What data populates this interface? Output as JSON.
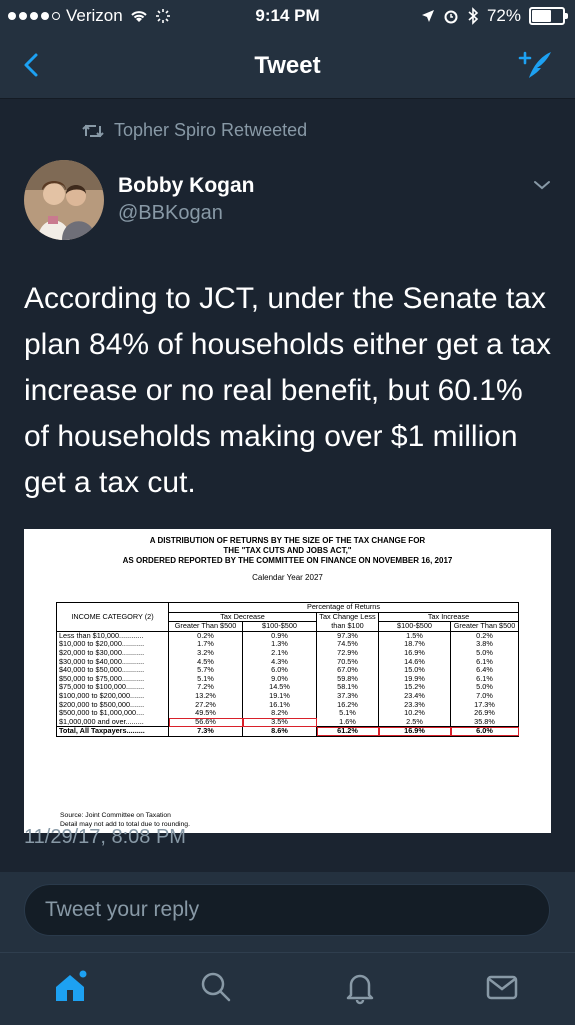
{
  "status_bar": {
    "carrier": "Verizon",
    "time": "9:14 PM",
    "battery": "72%",
    "battery_level": 0.72
  },
  "nav": {
    "title": "Tweet",
    "back_icon": "chevron-left-icon",
    "compose_icon": "compose-tweet-icon"
  },
  "tweet": {
    "retweeted_by": "Topher Spiro Retweeted",
    "author_name": "Bobby Kogan",
    "author_handle": "@BBKogan",
    "text": "According to JCT, under the Senate tax plan 84% of households either get a tax increase or no real benefit, but 60.1% of households making over $1 million get a tax cut.",
    "timestamp": "11/29/17, 8:08 PM"
  },
  "attached_table": {
    "title_lines": [
      "A DISTRIBUTION OF RETURNS BY THE SIZE OF THE TAX CHANGE FOR",
      "THE \"TAX CUTS AND JOBS ACT,\"",
      "AS ORDERED REPORTED BY THE COMMITTEE ON FINANCE ON NOVEMBER 16, 2017"
    ],
    "calendar_year": "Calendar Year 2027",
    "header": {
      "income_category": "INCOME CATEGORY (2)",
      "pct_returns": "Percentage of Returns",
      "tax_decrease": "Tax Decrease",
      "tax_change": "Tax Change Less than $100",
      "tax_increase": "Tax Increase",
      "dec_gt": "Greater Than $500",
      "dec_range": "$100-$500",
      "change_lt": "$100",
      "inc_range": "$100-$500",
      "inc_gt": "Greater Than $500"
    },
    "rows": [
      {
        "category": "Less than $10,000............",
        "values": [
          "0.2%",
          "0.9%",
          "97.3%",
          "1.5%",
          "0.2%"
        ]
      },
      {
        "category": "$10,000 to $20,000...........",
        "values": [
          "1.7%",
          "1.3%",
          "74.5%",
          "18.7%",
          "3.8%"
        ]
      },
      {
        "category": "$20,000 to $30,000...........",
        "values": [
          "3.2%",
          "2.1%",
          "72.9%",
          "16.9%",
          "5.0%"
        ]
      },
      {
        "category": "$30,000 to $40,000...........",
        "values": [
          "4.5%",
          "4.3%",
          "70.5%",
          "14.6%",
          "6.1%"
        ]
      },
      {
        "category": "$40,000 to $50,000...........",
        "values": [
          "5.7%",
          "6.0%",
          "67.0%",
          "15.0%",
          "6.4%"
        ]
      },
      {
        "category": "$50,000 to $75,000...........",
        "values": [
          "5.1%",
          "9.0%",
          "59.8%",
          "19.9%",
          "6.1%"
        ]
      },
      {
        "category": "$75,000 to $100,000.........",
        "values": [
          "7.2%",
          "14.5%",
          "58.1%",
          "15.2%",
          "5.0%"
        ]
      },
      {
        "category": "$100,000 to $200,000.......",
        "values": [
          "13.2%",
          "19.1%",
          "37.3%",
          "23.4%",
          "7.0%"
        ]
      },
      {
        "category": "$200,000 to $500,000.......",
        "values": [
          "27.2%",
          "16.1%",
          "16.2%",
          "23.3%",
          "17.3%"
        ]
      },
      {
        "category": "$500,000 to $1,000,000....",
        "values": [
          "49.5%",
          "8.2%",
          "5.1%",
          "10.2%",
          "26.9%"
        ]
      },
      {
        "category": "$1,000,000 and over.........",
        "values": [
          "56.6%",
          "3.5%",
          "1.6%",
          "2.5%",
          "35.8%"
        ]
      }
    ],
    "total": {
      "category": "Total, All Taxpayers.........",
      "values": [
        "7.3%",
        "8.6%",
        "61.2%",
        "16.9%",
        "6.0%"
      ]
    },
    "source": "Source:  Joint Committee on Taxation",
    "note": "Detail may not add to total due to rounding."
  },
  "reply": {
    "placeholder": "Tweet your reply"
  },
  "tabs": [
    {
      "icon": "home-icon"
    },
    {
      "icon": "search-icon"
    },
    {
      "icon": "notifications-bell-icon"
    },
    {
      "icon": "messages-envelope-icon"
    }
  ],
  "colors": {
    "background": "#1b2430",
    "bar": "#24313f",
    "accent": "#1da1f2",
    "muted": "#8899a6",
    "highlight_box": "#d8202a"
  }
}
